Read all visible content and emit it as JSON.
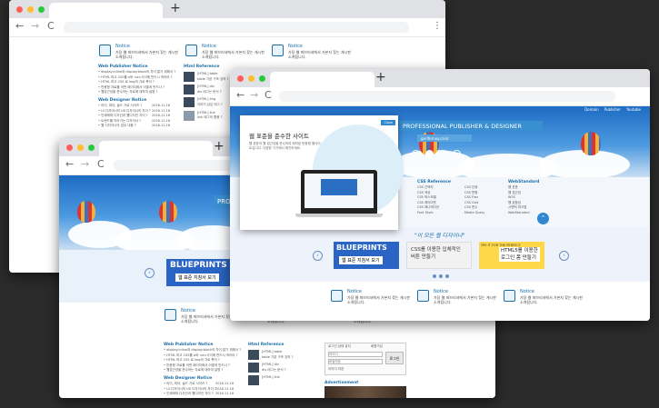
{
  "browser": {
    "new_tab": "+",
    "back": "←",
    "forward": "→",
    "reload": "C",
    "menu": "⋮"
  },
  "notice": {
    "title": "Notice",
    "text": "가장 웹 퍼브리셔에서 가본지 찾는 게시판 소개됩니다."
  },
  "sections": {
    "publisher": "Web Publisher Notice",
    "designer": "Web Designer Notice",
    "reference": "Html Reference",
    "html_reference": "Html Reference"
  },
  "publisher_items": [
    "• display:inline과 display:block의 차이 알기 위해서 ?",
    "• HTML 하고 CSS를 a와 <a>사이에 반드시 적어야 ?",
    "• HTML 하고 CSS 로 img의 가로 폭이 ?",
    "• 반응형 자료를 어떤 페이지에서 어떻게 만드나 ?",
    "• 웹접근성을 준수하는 자료에 대하여 설명 ?"
  ],
  "designer_items": [
    "• 라이, 피아, 솔드 가로 사이즈 ?",
    "• UI 디자이너의 UX 디자이너의 차이 ?",
    "• 인쇄매체 디자인과 웹디자인 차이 ?",
    "• 트렌드를 따라가는 디자이너 ?",
    "• 웹 디자이너의 업무 내용 ?"
  ],
  "designer_dates": [
    "2016.11.16",
    "2016.11.16",
    "2016.11.16",
    "2016.11.16",
    "2016.11.16"
  ],
  "reference_items": [
    "[HTML] table",
    "table 기본 구조 강의 ?",
    "[HTML] div",
    "div 태그는 문서 ?",
    "[HTML] img",
    "이미지 삽입 태그 ?",
    "[HTML] link",
    "link 태그의 활용 ?"
  ],
  "hero": {
    "title": "PROFESSIONAL PUBLISHER & DESIGNER",
    "subtitle": "gerlfernoy.co.kr",
    "nav": [
      "Domain",
      "Publisher",
      "Youtube"
    ],
    "title_short": "PRO"
  },
  "popup": {
    "label": "웹 표준을 준수한 사이트",
    "text": "웹 표준과 웹 접근성을 준수하여 제작된 반응형 웹사이트입니다. 다양한 기기에서 확인하세요.",
    "close": "Close"
  },
  "links": {
    "col1": "CSS Reference",
    "col1_items": [
      "CSS 선택자",
      "CSS 색상",
      "CSS 박스모델",
      "CSS 레이아웃",
      "CSS 애니메이션",
      "Font Style"
    ],
    "col2_items": [
      "CSS 단위",
      "CSS 변형",
      "CSS Flex",
      "CSS Grid",
      "CSS 변수",
      "Media Query"
    ],
    "col3": "WebStandard",
    "col3_items": [
      "웹 표준",
      "웹 접근성",
      "W3C",
      "웹 호환성",
      "시맨틱 마크업",
      "WebStandard"
    ]
  },
  "tagline": "\"이 모든 웹 디자이너\"",
  "banners": {
    "blueprints": "BLUEPRINTS",
    "blueprints_sub": "웹 표준 지침서 보기",
    "css": "CSS를 이용한 입체적인\n버튼 만들기",
    "html5": "HTML5를 이용한\n로그인 폼 만들기",
    "tag": "TRY IT FOR THE PERFECT"
  },
  "login": {
    "title": "로그인 상태 유지",
    "join": "회원가입",
    "id_placeholder": "아이디",
    "pw_placeholder": "비밀번호",
    "login_btn": "로그인",
    "save": "아이디 저장"
  },
  "banner_prev": "‹",
  "banner_next": "›",
  "advertisement": "Advertisement",
  "colors": {
    "accent": "#1b6fa8",
    "hero_bar": "#3a8fd0",
    "sky": "#3f8ed8",
    "banner_yellow": "#ffd84a",
    "blueprint_blue": "#2a64c4"
  }
}
